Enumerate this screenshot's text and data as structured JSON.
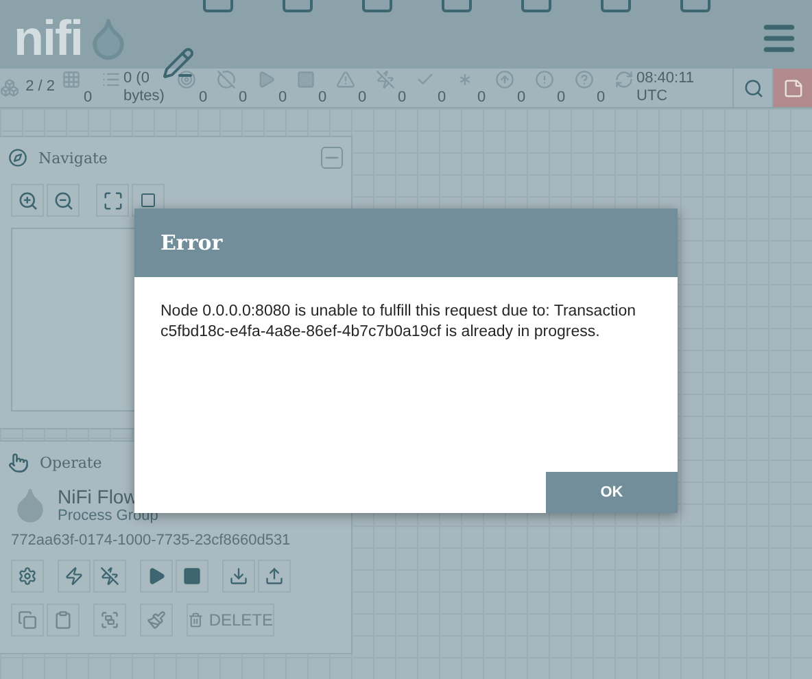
{
  "logo": {
    "text": "nifi"
  },
  "status_bar": {
    "items": [
      {
        "kind": "cluster",
        "text": "2 / 2"
      },
      {
        "kind": "components",
        "text": "0"
      },
      {
        "kind": "queued",
        "text": "0 (0 bytes)"
      },
      {
        "kind": "transmitting",
        "text": "0"
      },
      {
        "kind": "not_transmitting",
        "text": "0"
      },
      {
        "kind": "running",
        "text": "0"
      },
      {
        "kind": "stopped",
        "text": "0"
      },
      {
        "kind": "invalid",
        "text": "0"
      },
      {
        "kind": "disabled",
        "text": "0"
      },
      {
        "kind": "up_to_date",
        "text": "0"
      },
      {
        "kind": "modified",
        "text": "0"
      },
      {
        "kind": "stale",
        "text": "0"
      },
      {
        "kind": "sync_failure",
        "text": "0"
      },
      {
        "kind": "unknown",
        "text": "0"
      },
      {
        "kind": "refresh",
        "text": "08:40:11 UTC"
      }
    ]
  },
  "navigate": {
    "title": "Navigate"
  },
  "operate": {
    "title": "Operate",
    "group_name": "NiFi Flow",
    "group_type": "Process Group",
    "group_id": "772aa63f-0174-1000-7735-23cf8660d531",
    "actions": [
      {
        "kind": "configure",
        "disabled": false
      },
      {
        "kind": "enable",
        "disabled": false
      },
      {
        "kind": "disable",
        "disabled": false
      },
      {
        "kind": "start",
        "disabled": false
      },
      {
        "kind": "stop",
        "disabled": false
      },
      {
        "kind": "template_create",
        "disabled": false
      },
      {
        "kind": "template_upload",
        "disabled": false
      },
      {
        "kind": "copy",
        "disabled": true
      },
      {
        "kind": "paste",
        "disabled": true
      },
      {
        "kind": "group",
        "disabled": true
      },
      {
        "kind": "color",
        "disabled": true
      },
      {
        "kind": "delete",
        "label": "DELETE",
        "disabled": true
      }
    ]
  },
  "dialog": {
    "title": "Error",
    "message": "Node 0.0.0.0:8080 is unable to fulfill this request due to: Transaction c5fbd18c-e4fa-4a8e-86ef-4b7c7b0a19cf is already in progress.",
    "button": "OK"
  }
}
